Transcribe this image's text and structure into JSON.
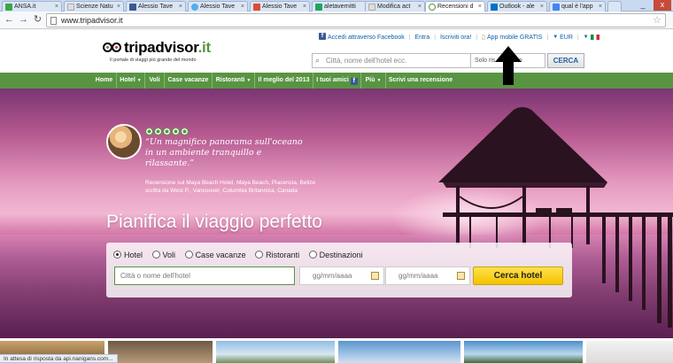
{
  "browser": {
    "tabs": [
      {
        "label": "ANSA.it",
        "color": "#3aa54a"
      },
      {
        "label": "Scienze Natu",
        "color": "#dddddd"
      },
      {
        "label": "Alessio Tave",
        "color": "#3b5998"
      },
      {
        "label": "Alessio Tave",
        "color": "#55acee"
      },
      {
        "label": "Alessio Tave",
        "color": "#dd4b39"
      },
      {
        "label": "aletavernitti",
        "color": "#1fa463"
      },
      {
        "label": "Modifica act",
        "color": "#dddddd"
      },
      {
        "label": "Recensioni d",
        "color": "#589442"
      },
      {
        "label": "Outlook - ale",
        "color": "#0072c6"
      },
      {
        "label": "qual è l'app",
        "color": "#4285f4"
      }
    ],
    "window_controls": {
      "minimize": "_",
      "close": "x"
    },
    "url": "www.tripadvisor.it"
  },
  "header": {
    "logo_text": "tripadvisor",
    "logo_tld": ".it",
    "tagline": "Il portale di viaggi più grande del mondo",
    "links": {
      "facebook": "Accedi attraverso Facebook",
      "login": "Entra",
      "signup": "Iscriviti ora!",
      "app": "App mobile GRATIS",
      "currency": "EUR"
    },
    "search": {
      "placeholder": "Città, nome dell'hotel ecc.",
      "scope": "Solo ris... Italiano",
      "button": "CERCA"
    }
  },
  "nav": {
    "items": [
      {
        "label": "Home"
      },
      {
        "label": "Hotel"
      },
      {
        "label": "Voli"
      },
      {
        "label": "Case vacanze"
      },
      {
        "label": "Ristoranti"
      },
      {
        "label": "Il meglio del 2013"
      },
      {
        "label": "I tuoi amici"
      },
      {
        "label": "Più"
      },
      {
        "label": "Scrivi una recensione"
      }
    ]
  },
  "hero": {
    "rating_bubbles": 5,
    "quote": "“Un magnifico panorama sull'oceano in un ambiente tranquillo e rilassante.”",
    "source": "Recensione sul Maya Beach Hotel, Maya Beach, Placencia, Belize scritta da West P., Vancouver, Columbia Britannica, Canada",
    "title": "Pianifica il viaggio perfetto"
  },
  "booking": {
    "options": [
      {
        "label": "Hotel",
        "checked": true
      },
      {
        "label": "Voli",
        "checked": false
      },
      {
        "label": "Case vacanze",
        "checked": false
      },
      {
        "label": "Ristoranti",
        "checked": false
      },
      {
        "label": "Destinazioni",
        "checked": false
      }
    ],
    "city_placeholder": "Città o nome dell'hotel",
    "checkin_placeholder": "gg/mm/aaaa",
    "checkout_placeholder": "gg/mm/aaaa",
    "button": "Cerca hotel"
  },
  "status": "In attesa di risposta da api.nanigans.com..."
}
